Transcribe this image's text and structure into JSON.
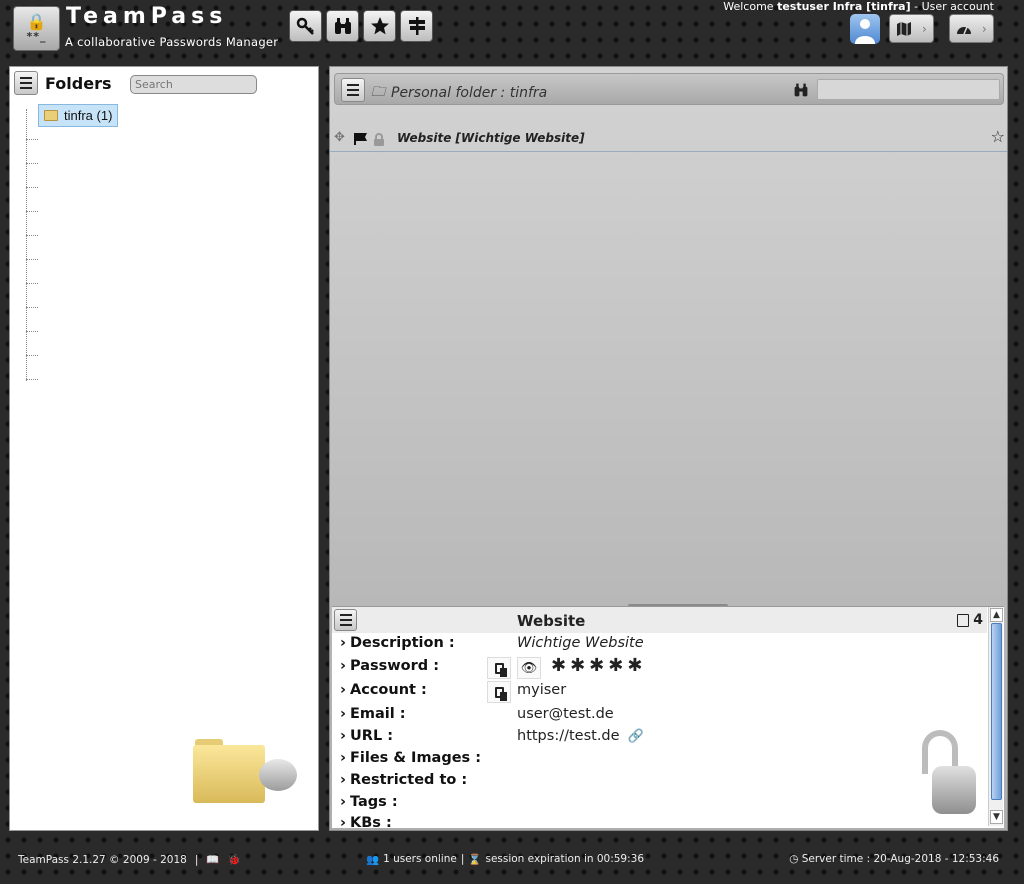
{
  "header": {
    "logo_lock": "🔒",
    "logo_stars": "**_",
    "app_title": "TeamPass",
    "app_subtitle": "A collaborative Passwords Manager",
    "welcome_prefix": "Welcome",
    "welcome_user": "testuser Infra [tinfra]",
    "welcome_suffix": " - User account",
    "toolbar": [
      {
        "name": "items-button",
        "icon": "key-icon",
        "glyph": "🔑"
      },
      {
        "name": "find-button",
        "icon": "binoculars-icon",
        "glyph": "⚲"
      },
      {
        "name": "favourites-button",
        "icon": "star-icon",
        "glyph": "★"
      },
      {
        "name": "suggestions-button",
        "icon": "signpost-icon",
        "glyph": "⇅"
      }
    ],
    "map_glyph": "▤",
    "dashboard_glyph": "◔",
    "chevron": "›"
  },
  "folders": {
    "title": "Folders",
    "search_placeholder": "Search",
    "tree_node": "tinfra (1)"
  },
  "main": {
    "folder_path": "Personal folder : tinfra",
    "folder_icon": "🗀",
    "binoculars": "⚲",
    "item_icons": {
      "move": "✥",
      "flag": "⚑",
      "lock": "🔒"
    },
    "item_label": "Website [Wichtige Website]",
    "star": "☆"
  },
  "details": {
    "title": "Website",
    "notes_count": "4",
    "fields": [
      {
        "label": "Description :",
        "value": "Wichtige Website",
        "italic": true
      },
      {
        "label": "Password :",
        "value": "✱✱✱✱✱"
      },
      {
        "label": "Account :",
        "value": "myiser"
      },
      {
        "label": "Email :",
        "value": "user@test.de"
      },
      {
        "label": "URL :",
        "value": "https://test.de"
      },
      {
        "label": "Files & Images :",
        "value": ""
      },
      {
        "label": "Restricted to :",
        "value": ""
      },
      {
        "label": "Tags :",
        "value": ""
      },
      {
        "label": "KBs :",
        "value": ""
      }
    ],
    "eye": "👁",
    "link": "🔗",
    "scroll_up": "▲",
    "scroll_down": "▼"
  },
  "footer": {
    "version": "TeamPass 2.1.27 © 2009 - 2018",
    "sep": "|",
    "book_glyph": "📖",
    "bug_glyph": "🐞",
    "users_icon": "👥",
    "users_online": "1 users online",
    "hourglass": "⌛",
    "session": "session expiration in 00:59:36",
    "server_time": "◷ Server time : 20-Aug-2018 - 12:53:46"
  },
  "colors": {
    "background": "#2a2a2a",
    "selected_node": "#c6e3f7",
    "scroll_thumb": "#6e9ed9"
  }
}
